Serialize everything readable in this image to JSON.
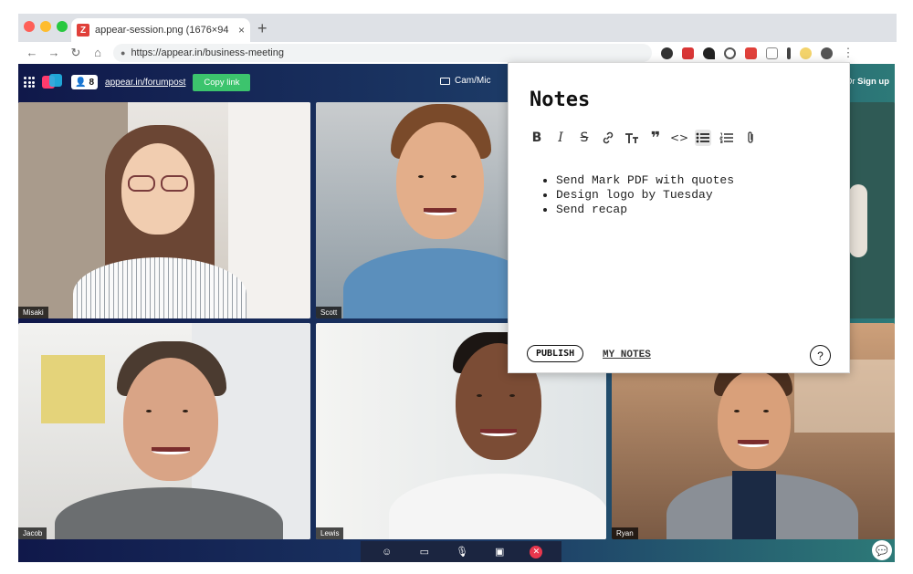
{
  "browser": {
    "tab_title": "appear-session.png (1676×94",
    "tab_favicon": "Z",
    "tab_close": "×",
    "new_tab": "+",
    "url": "https://appear.in/business-meeting",
    "nav": {
      "back": "←",
      "forward": "→",
      "reload": "↻",
      "home": "⌂"
    },
    "traffic_colors": [
      "#fe5f57",
      "#febc2e",
      "#28c840"
    ]
  },
  "app": {
    "participant_count": "8",
    "room_link": "appear.in/forumpost",
    "copy_link_label": "Copy link",
    "cammic_label": "Cam/Mic",
    "signup_prefix": "Or",
    "signup_label": "Sign up",
    "participants": [
      {
        "name": "Misaki"
      },
      {
        "name": "Scott"
      },
      {
        "name": "Jacob"
      },
      {
        "name": "Lewis"
      },
      {
        "name": "Ryan"
      }
    ],
    "controls": [
      "smiley-icon",
      "screen-share-icon",
      "microphone-icon",
      "camera-icon",
      "leave-icon"
    ]
  },
  "notes": {
    "title": "Notes",
    "toolbar": [
      "B",
      "I",
      "S",
      "🔗",
      "T",
      "❞",
      "<>",
      "≡",
      "≣",
      "📎"
    ],
    "items": [
      "Send Mark PDF with quotes",
      "Design logo by Tuesday",
      "Send recap"
    ],
    "publish_label": "PUBLISH",
    "my_notes_label": "MY NOTES",
    "help_label": "?"
  },
  "colors": {
    "accent_green": "#3cc46d",
    "leave_red": "#e8374d",
    "app_bg_start": "#10184a",
    "app_bg_end": "#2d7a78"
  }
}
